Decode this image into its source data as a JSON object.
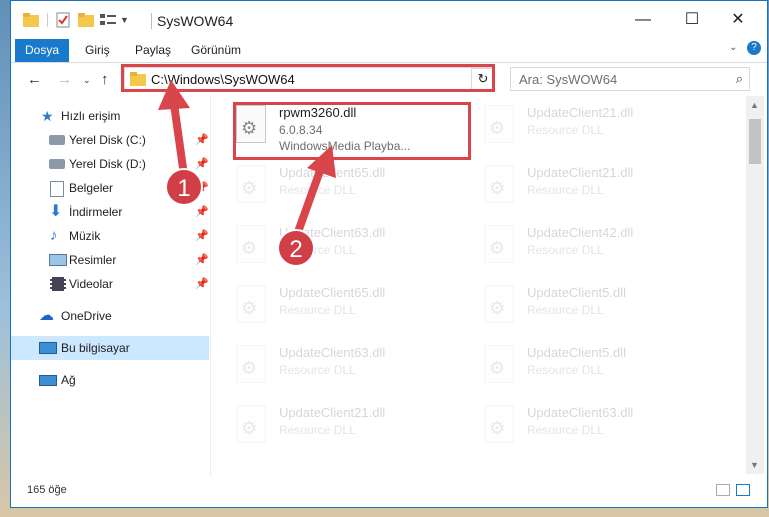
{
  "window": {
    "title": "SysWOW64",
    "controls": {
      "minimize": "—",
      "maximize": "☐",
      "close": "✕"
    }
  },
  "ribbon": {
    "tabs": [
      "Dosya",
      "Giriş",
      "Paylaş",
      "Görünüm"
    ],
    "help": "?"
  },
  "nav": {
    "address": "C:\\Windows\\SysWOW64",
    "search_placeholder": "Ara: SysWOW64",
    "refresh_icon": "↻",
    "back_icon": "←",
    "forward_icon": "→",
    "up_icon": "↑"
  },
  "sidebar": {
    "items": [
      {
        "label": "Hızlı erişim",
        "icon": "star-icon"
      },
      {
        "label": "Yerel Disk (C:)",
        "icon": "drive-icon"
      },
      {
        "label": "Yerel Disk (D:)",
        "icon": "drive-icon"
      },
      {
        "label": "Belgeler",
        "icon": "document-icon"
      },
      {
        "label": "İndirmeler",
        "icon": "download-icon"
      },
      {
        "label": "Müzik",
        "icon": "music-icon"
      },
      {
        "label": "Resimler",
        "icon": "picture-icon"
      },
      {
        "label": "Videolar",
        "icon": "video-icon"
      },
      {
        "label": "OneDrive",
        "icon": "cloud-icon"
      },
      {
        "label": "Bu bilgisayar",
        "icon": "computer-icon"
      },
      {
        "label": "Ağ",
        "icon": "network-icon"
      }
    ]
  },
  "files": {
    "highlighted": {
      "name": "rpwm3260.dll",
      "version": "6.0.8.34",
      "desc": "WindowsMedia Playba..."
    },
    "faded": [
      {
        "name": "UpdateClient21.dll",
        "type": "Resource DLL"
      },
      {
        "name": "UpdateClient65.dll",
        "type": "Resource DLL"
      },
      {
        "name": "UpdateClient21.dll",
        "type": "Resource DLL"
      },
      {
        "name": "UpdateClient63.dll",
        "type": "Resource DLL"
      },
      {
        "name": "UpdateClient42.dll",
        "type": "Resource DLL"
      },
      {
        "name": "UpdateClient65.dll",
        "type": "Resource DLL"
      },
      {
        "name": "UpdateClient5.dll",
        "type": "Resource DLL"
      },
      {
        "name": "UpdateClient63.dll",
        "type": "Resource DLL"
      },
      {
        "name": "UpdateClient5.dll",
        "type": "Resource DLL"
      },
      {
        "name": "UpdateClient21.dll",
        "type": "Resource DLL"
      },
      {
        "name": "UpdateClient63.dll",
        "type": "Resource DLL"
      }
    ]
  },
  "status": {
    "count": "165 öğe"
  },
  "callouts": [
    "1",
    "2"
  ],
  "colors": {
    "accent": "#1979ca",
    "highlight": "#d8464b",
    "selected": "#cce8ff"
  }
}
